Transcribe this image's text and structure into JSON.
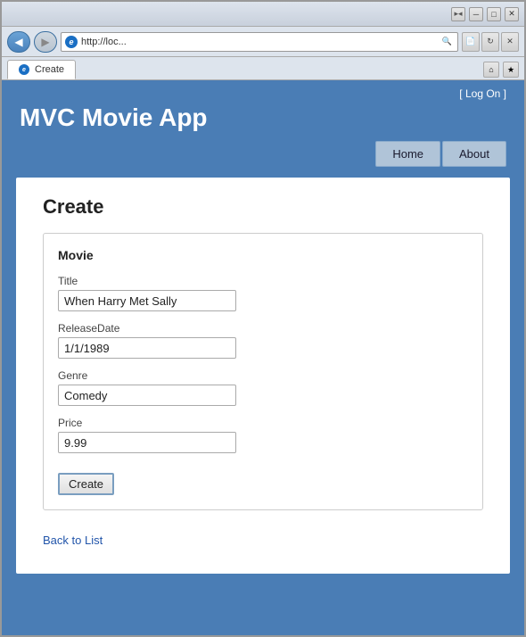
{
  "browser": {
    "title": "Create",
    "address": "http://loc...",
    "title_bar_buttons": [
      "▸◂",
      "□",
      "─",
      "□",
      "✕"
    ],
    "nav_back_icon": "◀",
    "nav_forward_icon": "▶",
    "ie_label": "e",
    "tab_label": "Create",
    "right_icons": [
      "⌂",
      "★"
    ]
  },
  "header": {
    "log_on_text": "[ Log On ]",
    "app_title": "MVC Movie App",
    "nav_items": [
      {
        "label": "Home",
        "id": "home"
      },
      {
        "label": "About",
        "id": "about"
      }
    ]
  },
  "page": {
    "title": "Create",
    "form_section_title": "Movie",
    "fields": [
      {
        "label": "Title",
        "value": "When Harry Met Sally",
        "name": "title"
      },
      {
        "label": "ReleaseDate",
        "value": "1/1/1989",
        "name": "release-date"
      },
      {
        "label": "Genre",
        "value": "Comedy",
        "name": "genre"
      },
      {
        "label": "Price",
        "value": "9.99",
        "name": "price"
      }
    ],
    "create_button": "Create",
    "back_link": "Back to List"
  }
}
